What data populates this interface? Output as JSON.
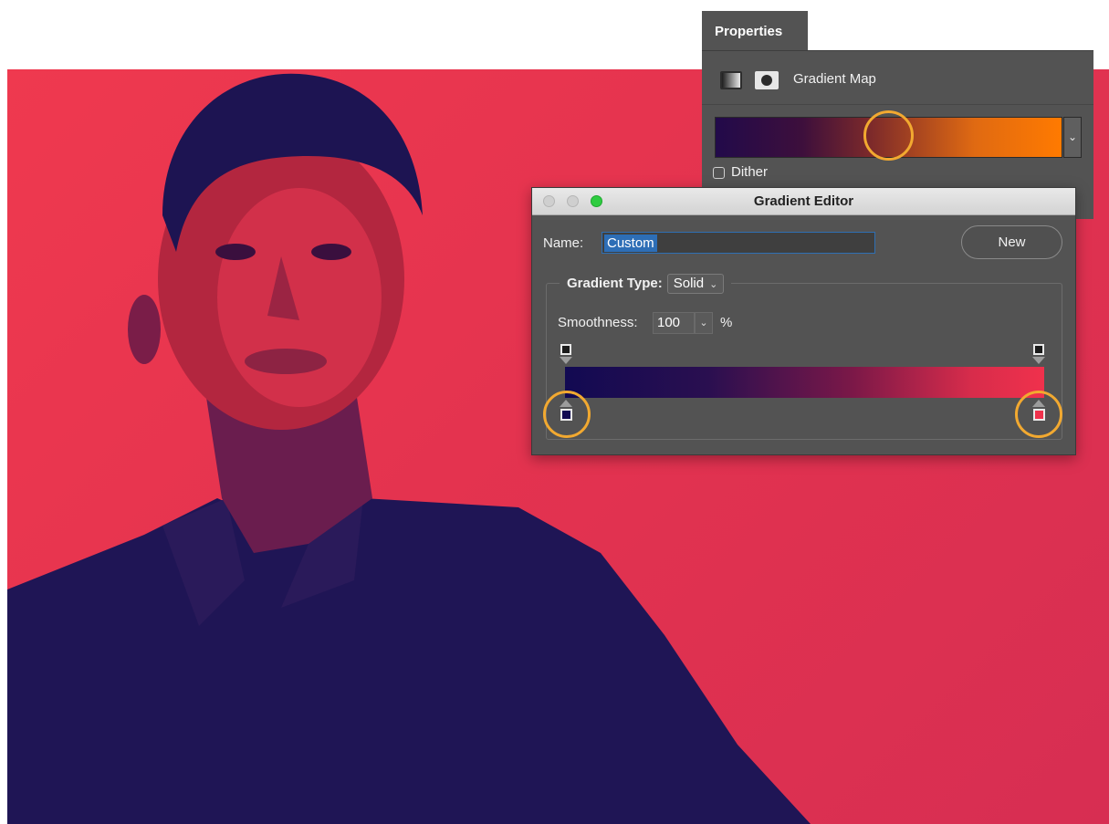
{
  "colors": {
    "photo_bg_light": "#ef394f",
    "photo_bg_dark": "#d72e52",
    "shadow_tone": "#1d1452",
    "highlight_ring": "#f2a930",
    "panel_bg": "#535353"
  },
  "properties": {
    "tab_label": "Properties",
    "adjustment_icon": "gradient-map-adjustment-icon",
    "mask_icon": "layer-mask-icon",
    "title": "Gradient Map",
    "gradient_colors": [
      "#220a4a",
      "#7d2a2a",
      "#ff7a00"
    ],
    "dropdown_icon": "chevron-down-icon",
    "dither_label": "Dither",
    "dither_checked": false
  },
  "gradient_editor": {
    "title": "Gradient Editor",
    "window_controls": [
      "close",
      "minimize",
      "zoom"
    ],
    "name_label": "Name:",
    "name_value": "Custom",
    "new_button": "New",
    "gradient_type_label": "Gradient Type:",
    "gradient_type_value": "Solid",
    "smoothness_label": "Smoothness:",
    "smoothness_value": "100",
    "smoothness_unit": "%",
    "ramp_colors": [
      "#120a52",
      "#f0314c"
    ],
    "left_color_stop": "#120a52",
    "right_color_stop": "#f0314c"
  }
}
